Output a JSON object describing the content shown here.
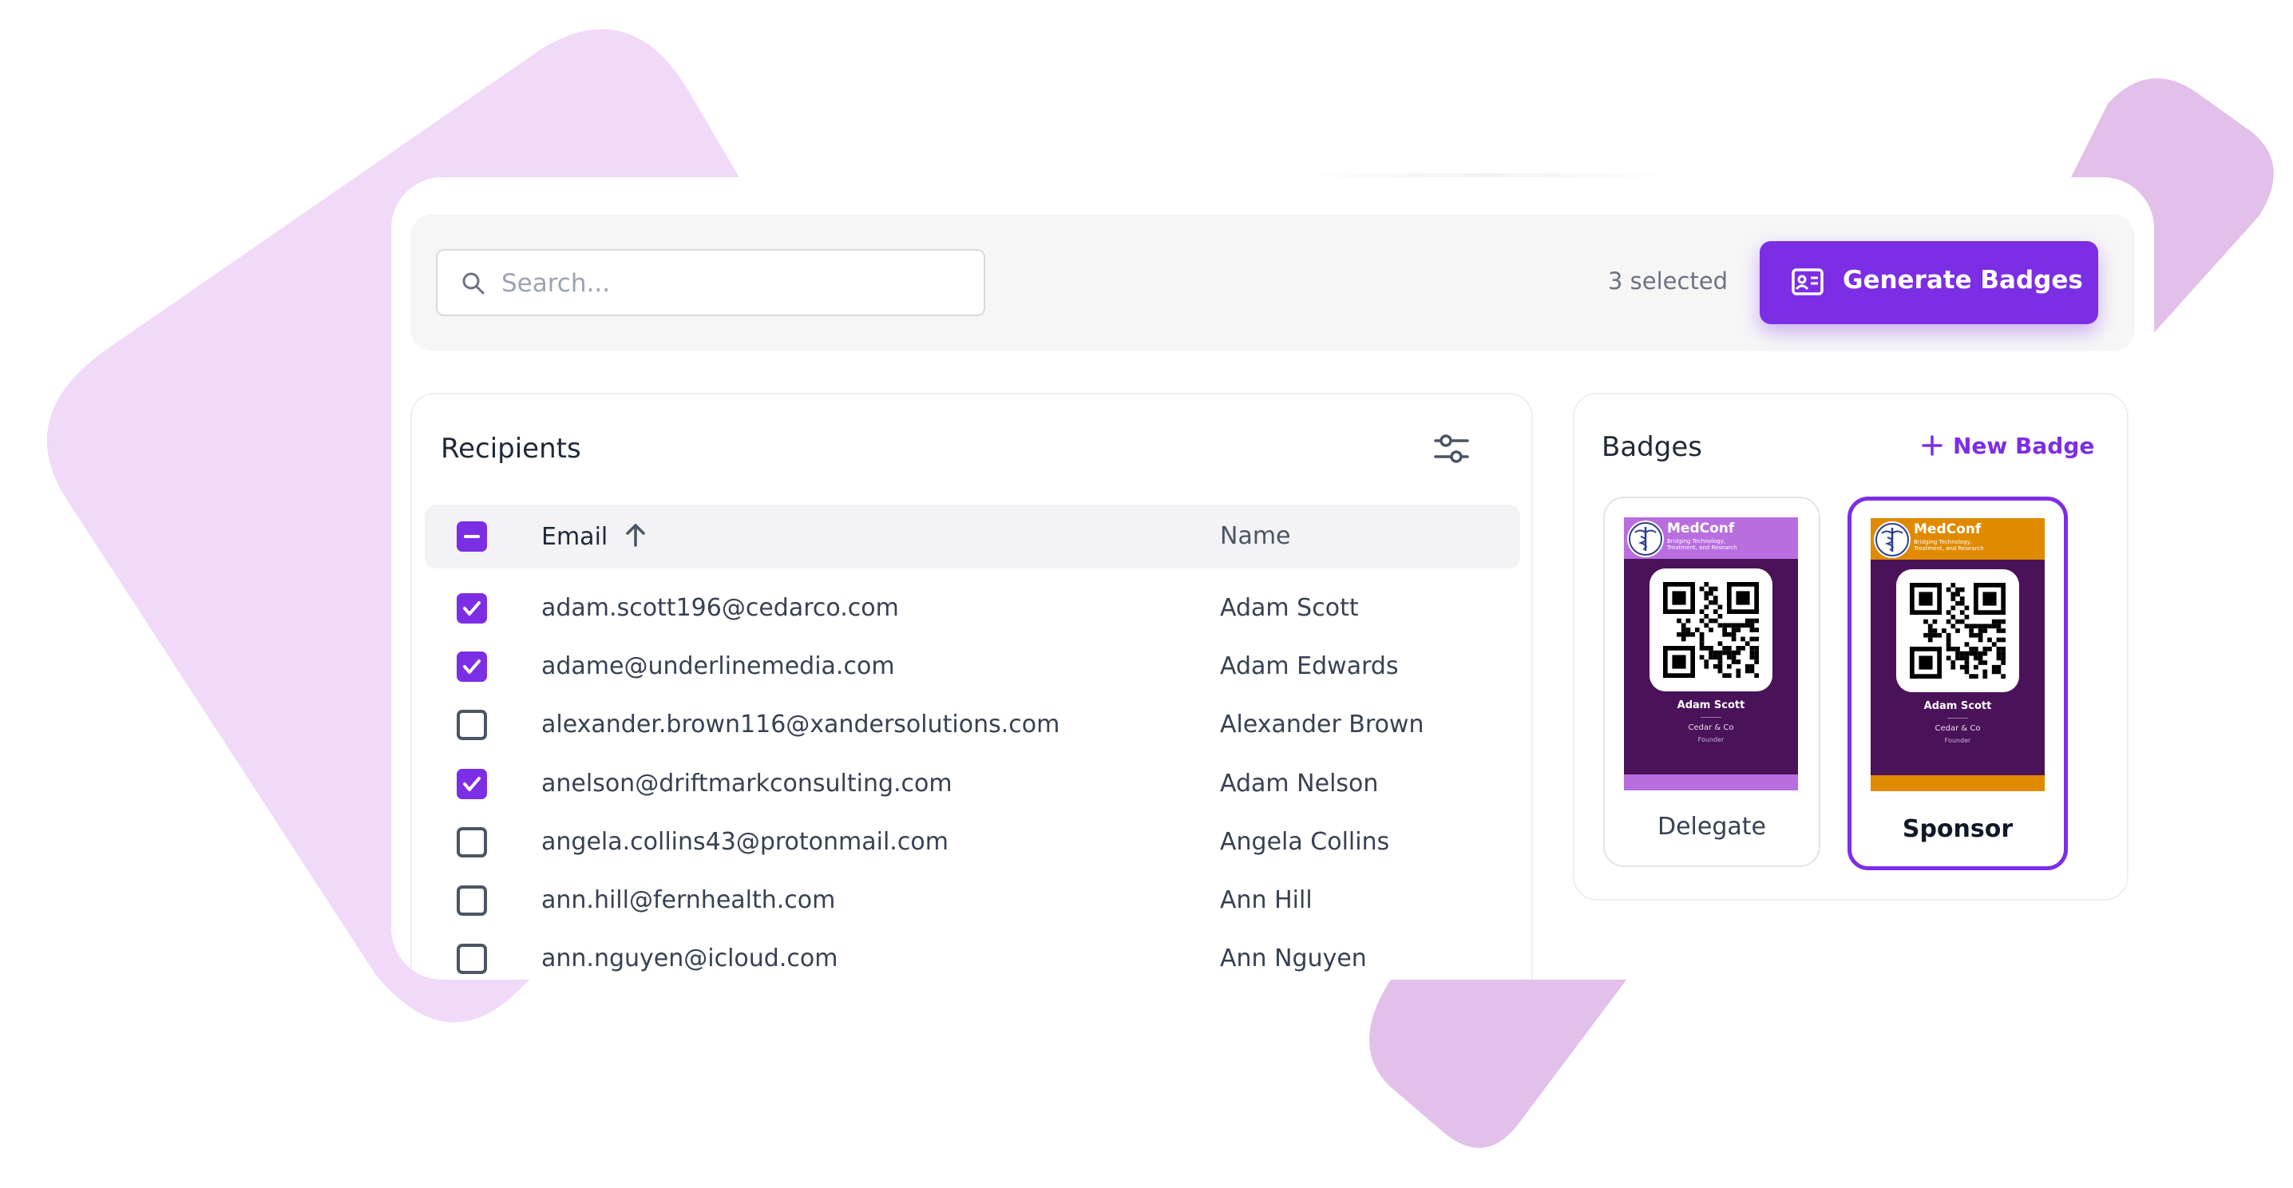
{
  "colors": {
    "accent": "#7c2ee5",
    "blob_light": "#f1d9f8",
    "blob_dark": "#e2c0ea",
    "delegate_header": "#b96ee0",
    "sponsor_header": "#e08a00",
    "badge_body": "#4a1258"
  },
  "toolbar": {
    "search_placeholder": "Search...",
    "selected_count": "3 selected",
    "generate_label": "Generate Badges",
    "generate_icon": "id-card-icon"
  },
  "recipients": {
    "title": "Recipients",
    "filter_icon": "sliders-icon",
    "header_checkbox_state": "indeterminate",
    "columns": {
      "email": "Email",
      "name": "Name"
    },
    "sort": {
      "column": "email",
      "direction": "ascending",
      "icon": "arrow-up-icon"
    },
    "rows": [
      {
        "email": "adam.scott196@cedarco.com",
        "name": "Adam Scott",
        "checked": true
      },
      {
        "email": "adame@underlinemedia.com",
        "name": "Adam Edwards",
        "checked": true
      },
      {
        "email": "alexander.brown116@xandersolutions.com",
        "name": "Alexander Brown",
        "checked": false
      },
      {
        "email": "anelson@driftmarkconsulting.com",
        "name": "Adam Nelson",
        "checked": true
      },
      {
        "email": "angela.collins43@protonmail.com",
        "name": "Angela Collins",
        "checked": false
      },
      {
        "email": "ann.hill@fernhealth.com",
        "name": "Ann Hill",
        "checked": false
      },
      {
        "email": "ann.nguyen@icloud.com",
        "name": "Ann Nguyen",
        "checked": false
      }
    ]
  },
  "badges": {
    "title": "Badges",
    "new_badge_label": "New Badge",
    "new_badge_icon": "plus-icon",
    "items": [
      {
        "label": "Delegate",
        "selected": false,
        "conference": "MedConf",
        "tagline_1": "Bridging Technology,",
        "tagline_2": "Treatment, and Research",
        "person_name": "Adam Scott",
        "company": "Cedar & Co",
        "role": "Founder"
      },
      {
        "label": "Sponsor",
        "selected": true,
        "conference": "MedConf",
        "tagline_1": "Bridging Technology,",
        "tagline_2": "Treatment, and Research",
        "person_name": "Adam Scott",
        "company": "Cedar & Co",
        "role": "Founder"
      }
    ]
  }
}
